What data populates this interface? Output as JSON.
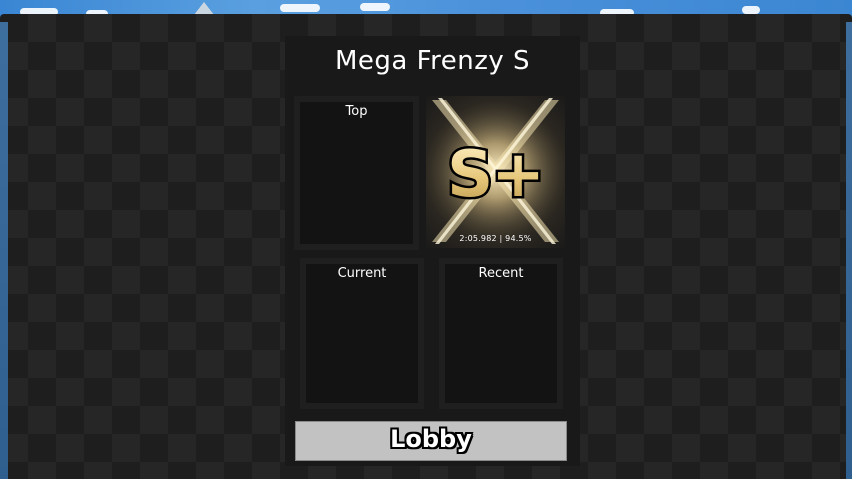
{
  "song": {
    "title": "Mega Frenzy S"
  },
  "panels": {
    "top_label": "Top",
    "current_label": "Current",
    "recent_label": "Recent"
  },
  "best_score": {
    "grade": "S+",
    "stats": "2:05.982 | 94.5%",
    "grade_color": "#e6c77a"
  },
  "actions": {
    "lobby_label": "Lobby"
  },
  "colors": {
    "panel_bg": "#191919",
    "button_bg": "#c2c2c2"
  }
}
